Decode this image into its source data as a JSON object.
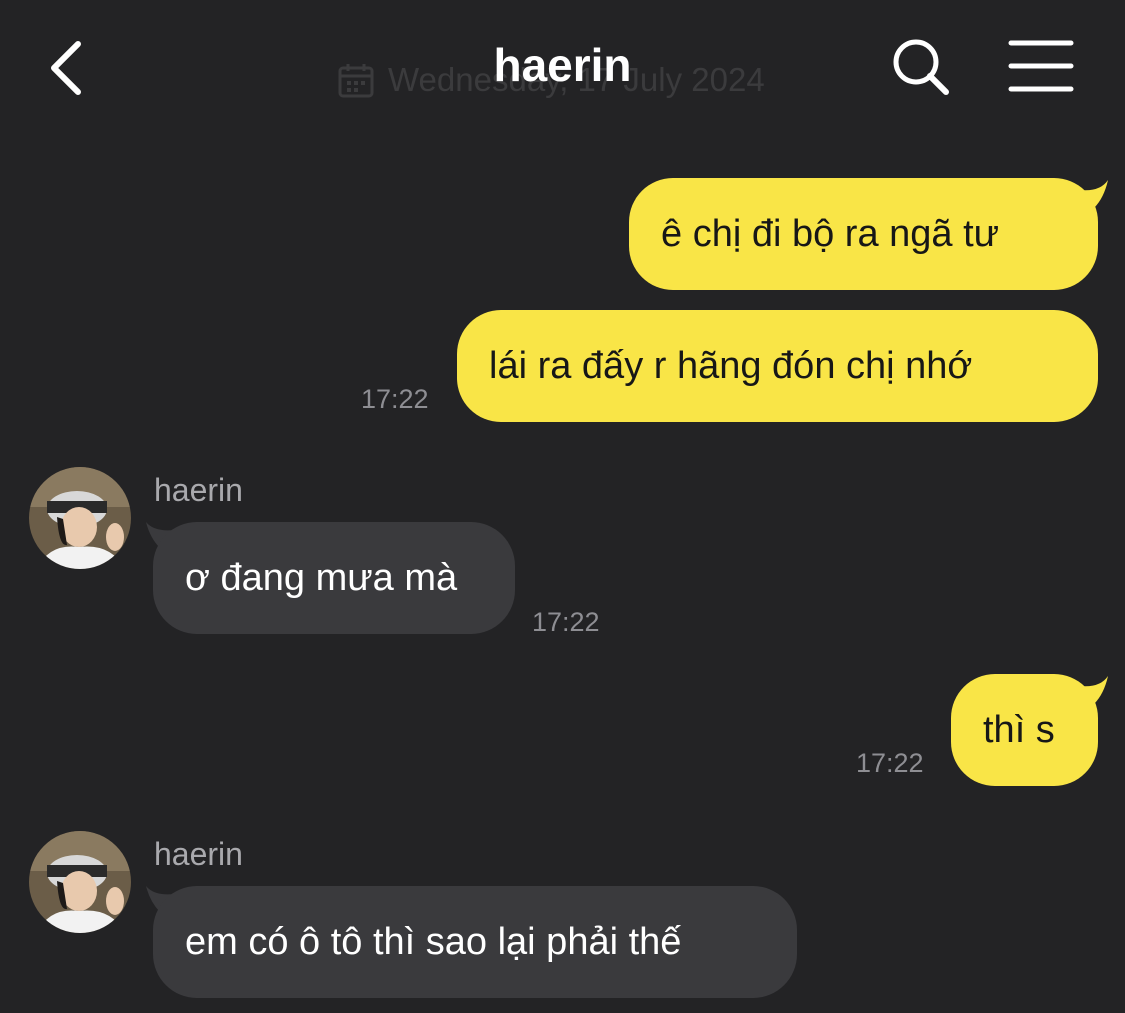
{
  "header": {
    "title": "haerin",
    "date": "Wednesday, 17 July 2024",
    "back_icon": "chevron-left-icon",
    "search_icon": "search-icon",
    "menu_icon": "hamburger-menu-icon"
  },
  "colors": {
    "background": "#232325",
    "outgoing_bubble": "#f9e547",
    "incoming_bubble": "#3a3a3d",
    "timestamp": "#8e8e93",
    "sender_name": "#a9a9ad"
  },
  "messages": [
    {
      "direction": "out",
      "text": "ê chị đi bộ ra ngã tư"
    },
    {
      "direction": "out",
      "text": "lái ra đấy r hãng đón chị nhớ",
      "time": "17:22"
    },
    {
      "direction": "in",
      "sender": "haerin",
      "text": "ơ đang mưa mà",
      "time": "17:22"
    },
    {
      "direction": "out",
      "text": "thì s",
      "time": "17:22"
    },
    {
      "direction": "in",
      "sender": "haerin",
      "text": "em có ô tô thì sao lại phải thế"
    }
  ]
}
